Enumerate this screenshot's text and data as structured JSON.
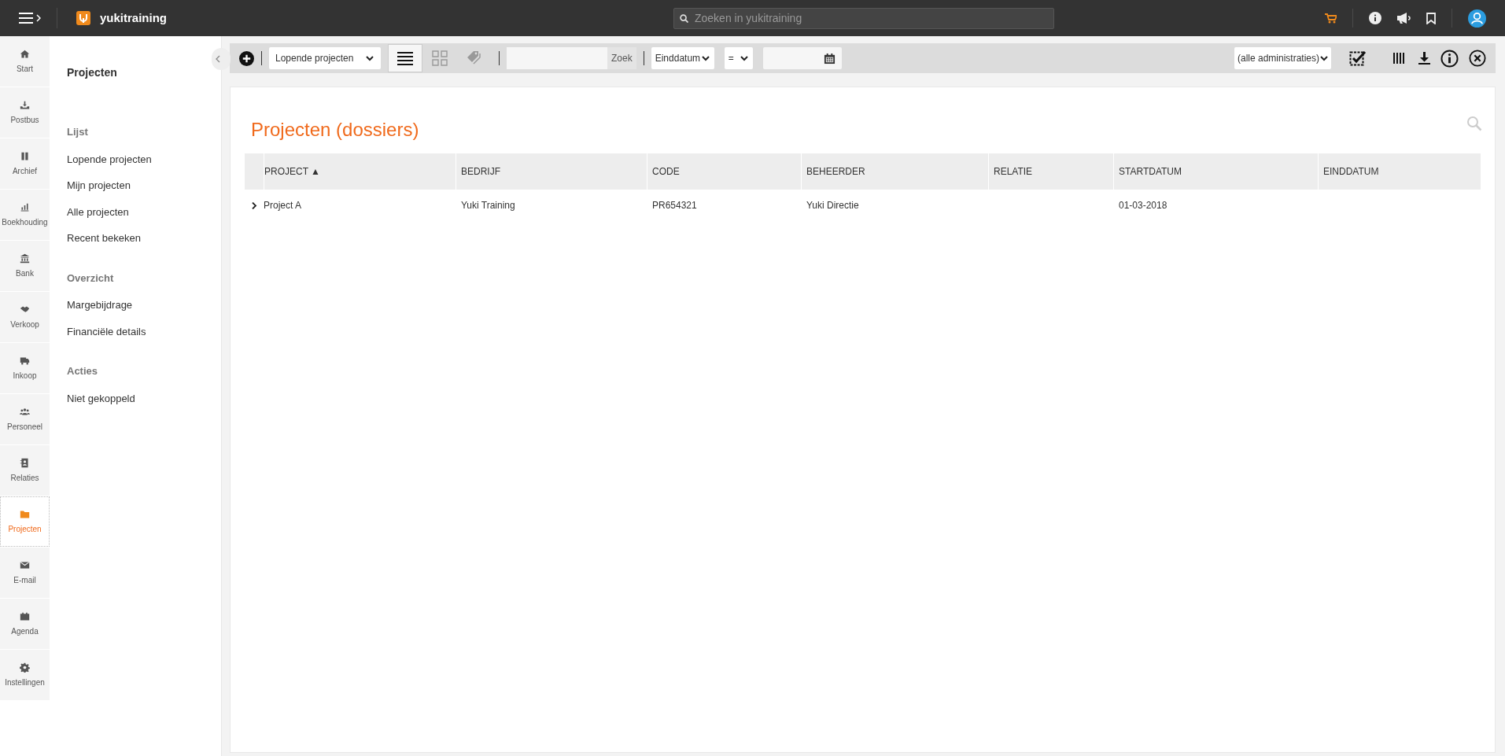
{
  "topbar": {
    "brand": "yukitraining",
    "search": {
      "placeholder": "Zoeken in yukitraining"
    }
  },
  "nav": [
    {
      "label": "Start",
      "selected": false
    },
    {
      "label": "Postbus",
      "selected": false
    },
    {
      "label": "Archief",
      "selected": false
    },
    {
      "label": "Boekhouding",
      "selected": false
    },
    {
      "label": "Bank",
      "selected": false
    },
    {
      "label": "Verkoop",
      "selected": false
    },
    {
      "label": "Inkoop",
      "selected": false
    },
    {
      "label": "Personeel",
      "selected": false
    },
    {
      "label": "Relaties",
      "selected": false
    },
    {
      "label": "Projecten",
      "selected": true
    },
    {
      "label": "E-mail",
      "selected": false
    },
    {
      "label": "Agenda",
      "selected": false
    },
    {
      "label": "Instellingen",
      "selected": false
    }
  ],
  "subnav": {
    "title": "Projecten",
    "sections": [
      {
        "heading": "Lijst",
        "items": [
          "Lopende projecten",
          "Mijn projecten",
          "Alle projecten",
          "Recent bekeken"
        ]
      },
      {
        "heading": "Overzicht",
        "items": [
          "Margebijdrage",
          "Financiële details"
        ]
      },
      {
        "heading": "Acties",
        "items": [
          "Niet gekoppeld"
        ]
      }
    ]
  },
  "toolbar": {
    "list_filter": "Lopende projecten",
    "views": [
      {
        "kind": "list",
        "selected": true
      },
      {
        "kind": "grid",
        "selected": false
      },
      {
        "kind": "tags",
        "selected": false
      }
    ],
    "search_button": "Zoek",
    "date_field": "Einddatum",
    "operator": "=",
    "administration": "(alle administraties)"
  },
  "page": {
    "title": "Projecten (dossiers)",
    "table": {
      "columns": [
        {
          "label": "PROJECT",
          "sort": "▲"
        },
        {
          "label": "BEDRIJF"
        },
        {
          "label": "CODE"
        },
        {
          "label": "BEHEERDER"
        },
        {
          "label": "RELATIE"
        },
        {
          "label": "STARTDATUM"
        },
        {
          "label": "EINDDATUM"
        }
      ],
      "rows": [
        {
          "expanded": false,
          "cells": [
            "Project A",
            "Yuki Training",
            "PR654321",
            "Yuki Directie",
            "",
            "01-03-2018",
            ""
          ]
        }
      ]
    }
  }
}
